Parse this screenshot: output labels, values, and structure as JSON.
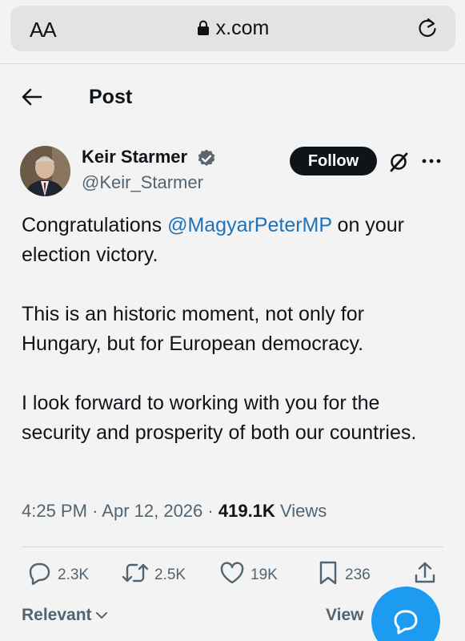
{
  "browser": {
    "text_size_label": "AA",
    "url": "x.com"
  },
  "header": {
    "title": "Post"
  },
  "author": {
    "name": "Keir Starmer",
    "handle": "@Keir_Starmer",
    "follow_label": "Follow"
  },
  "tweet": {
    "p1_before": "Congratulations ",
    "p1_mention": "@MagyarPeterMP",
    "p1_after": " on your election victory.",
    "p2": "This is an historic moment, not only for Hungary, but for European democracy.",
    "p3": "I look forward to working with you for the security and prosperity of both our countries."
  },
  "meta": {
    "time": "4:25 PM",
    "date": "Apr 12, 2026",
    "views_count": "419.1K",
    "views_label": "Views",
    "sep": "·"
  },
  "actions": {
    "replies": "2.3K",
    "reposts": "2.5K",
    "likes": "19K",
    "bookmarks": "236"
  },
  "footer": {
    "sort_label": "Relevant",
    "view_label": "View"
  },
  "colors": {
    "accent": "#1d9bf0",
    "mention": "#1d72b8",
    "verified": "#5b6670"
  }
}
